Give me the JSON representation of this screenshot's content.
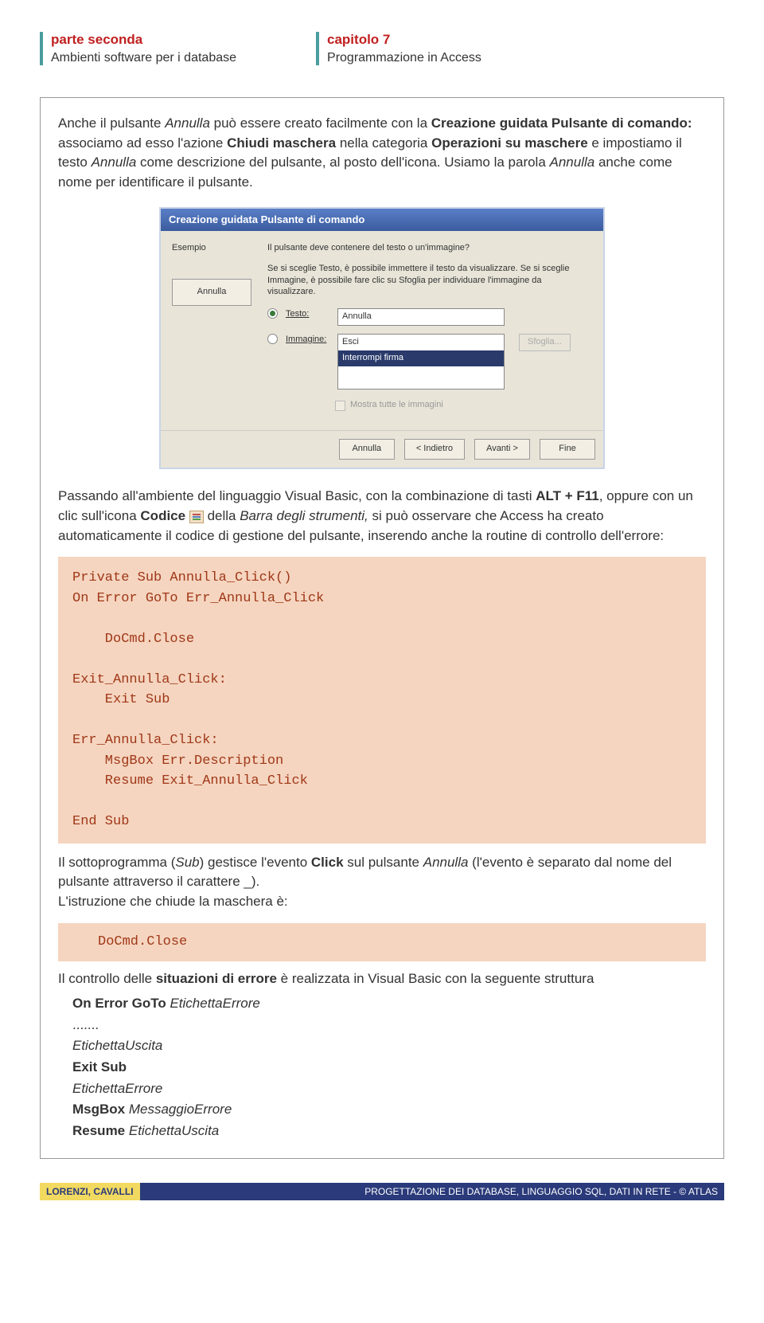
{
  "header": {
    "left_title": "parte seconda",
    "left_sub": "Ambienti software per i database",
    "right_title": "capitolo 7",
    "right_sub": "Programmazione in Access"
  },
  "p1_pre": "Anche il pulsante ",
  "p1_annulla": "Annulla",
  "p1_mid1": " può essere creato facilmente con la ",
  "p1_creazione": "Creazione guidata Pulsante di comando:",
  "p1_mid2": " associamo ad esso l'azione ",
  "p1_chiudi": "Chiudi maschera",
  "p1_mid3": " nella categoria ",
  "p1_operazioni": "Operazioni su maschere",
  "p1_mid4": " e impostiamo il testo ",
  "p1_annulla2": "Annulla",
  "p1_mid5": " come descrizione del pulsante, al posto dell'icona. Usiamo la parola ",
  "p1_annulla3": "Annulla",
  "p1_end": " anche come nome per identificare il pulsante.",
  "wizard": {
    "title": "Creazione guidata Pulsante di comando",
    "example_label": "Esempio",
    "sample_btn": "Annulla",
    "question": "Il pulsante deve contenere del testo o un'immagine?",
    "note": "Se si sceglie Testo, è possibile immettere il testo da visualizzare. Se si sceglie Immagine, è possibile fare clic su Sfoglia per individuare l'immagine da visualizzare.",
    "radio_text": "Testo:",
    "text_value": "Annulla",
    "radio_image": "Immagine:",
    "list_item1": "Esci",
    "list_item2": "Interrompi firma",
    "browse": "Sfoglia...",
    "show_all": "Mostra tutte le immagini",
    "btn_cancel": "Annulla",
    "btn_back": "< Indietro",
    "btn_next": "Avanti >",
    "btn_finish": "Fine"
  },
  "p2_pre": "Passando all'ambiente del linguaggio Visual Basic, con la combinazione di tasti ",
  "p2_alt": "ALT + F11",
  "p2_mid1": ", oppure con un clic sull'icona ",
  "p2_codice": "Codice",
  "p2_mid2": " della ",
  "p2_barra": "Barra degli strumenti,",
  "p2_end": " si può osservare che Access ha creato automaticamente il codice di gestione del pulsante, inserendo anche la routine di controllo dell'errore:",
  "code1": "Private Sub Annulla_Click()\nOn Error GoTo Err_Annulla_Click\n\n    DoCmd.Close\n\nExit_Annulla_Click:\n    Exit Sub\n\nErr_Annulla_Click:\n    MsgBox Err.Description\n    Resume Exit_Annulla_Click\n\nEnd Sub",
  "p3_pre": "Il sottoprogramma (",
  "p3_sub": "Sub",
  "p3_mid1": ") gestisce l'evento ",
  "p3_click": "Click",
  "p3_mid2": " sul pulsante ",
  "p3_annulla": "Annulla",
  "p3_end": " (l'evento è separato dal nome del pulsante attraverso il carattere _).",
  "p3_line2": "L'istruzione che chiude la maschera è:",
  "code2": "DoCmd.Close",
  "p4_pre": "Il controllo delle ",
  "p4_sit": "situazioni di errore",
  "p4_end": " è realizzata in Visual Basic con la seguente struttura",
  "struct": {
    "l1a": "On Error GoTo ",
    "l1b": "EtichettaErrore",
    "l2": ".......",
    "l3": "EtichettaUscita",
    "l4": "Exit Sub",
    "l5": "EtichettaErrore",
    "l6a": "MsgBox ",
    "l6b": "MessaggioErrore",
    "l7a": "Resume ",
    "l7b": "EtichettaUscita"
  },
  "footer": {
    "authors": "LORENZI, CAVALLI",
    "title": "PROGETTAZIONE DEI DATABASE, LINGUAGGIO SQL, DATI IN RETE - © ATLAS"
  }
}
